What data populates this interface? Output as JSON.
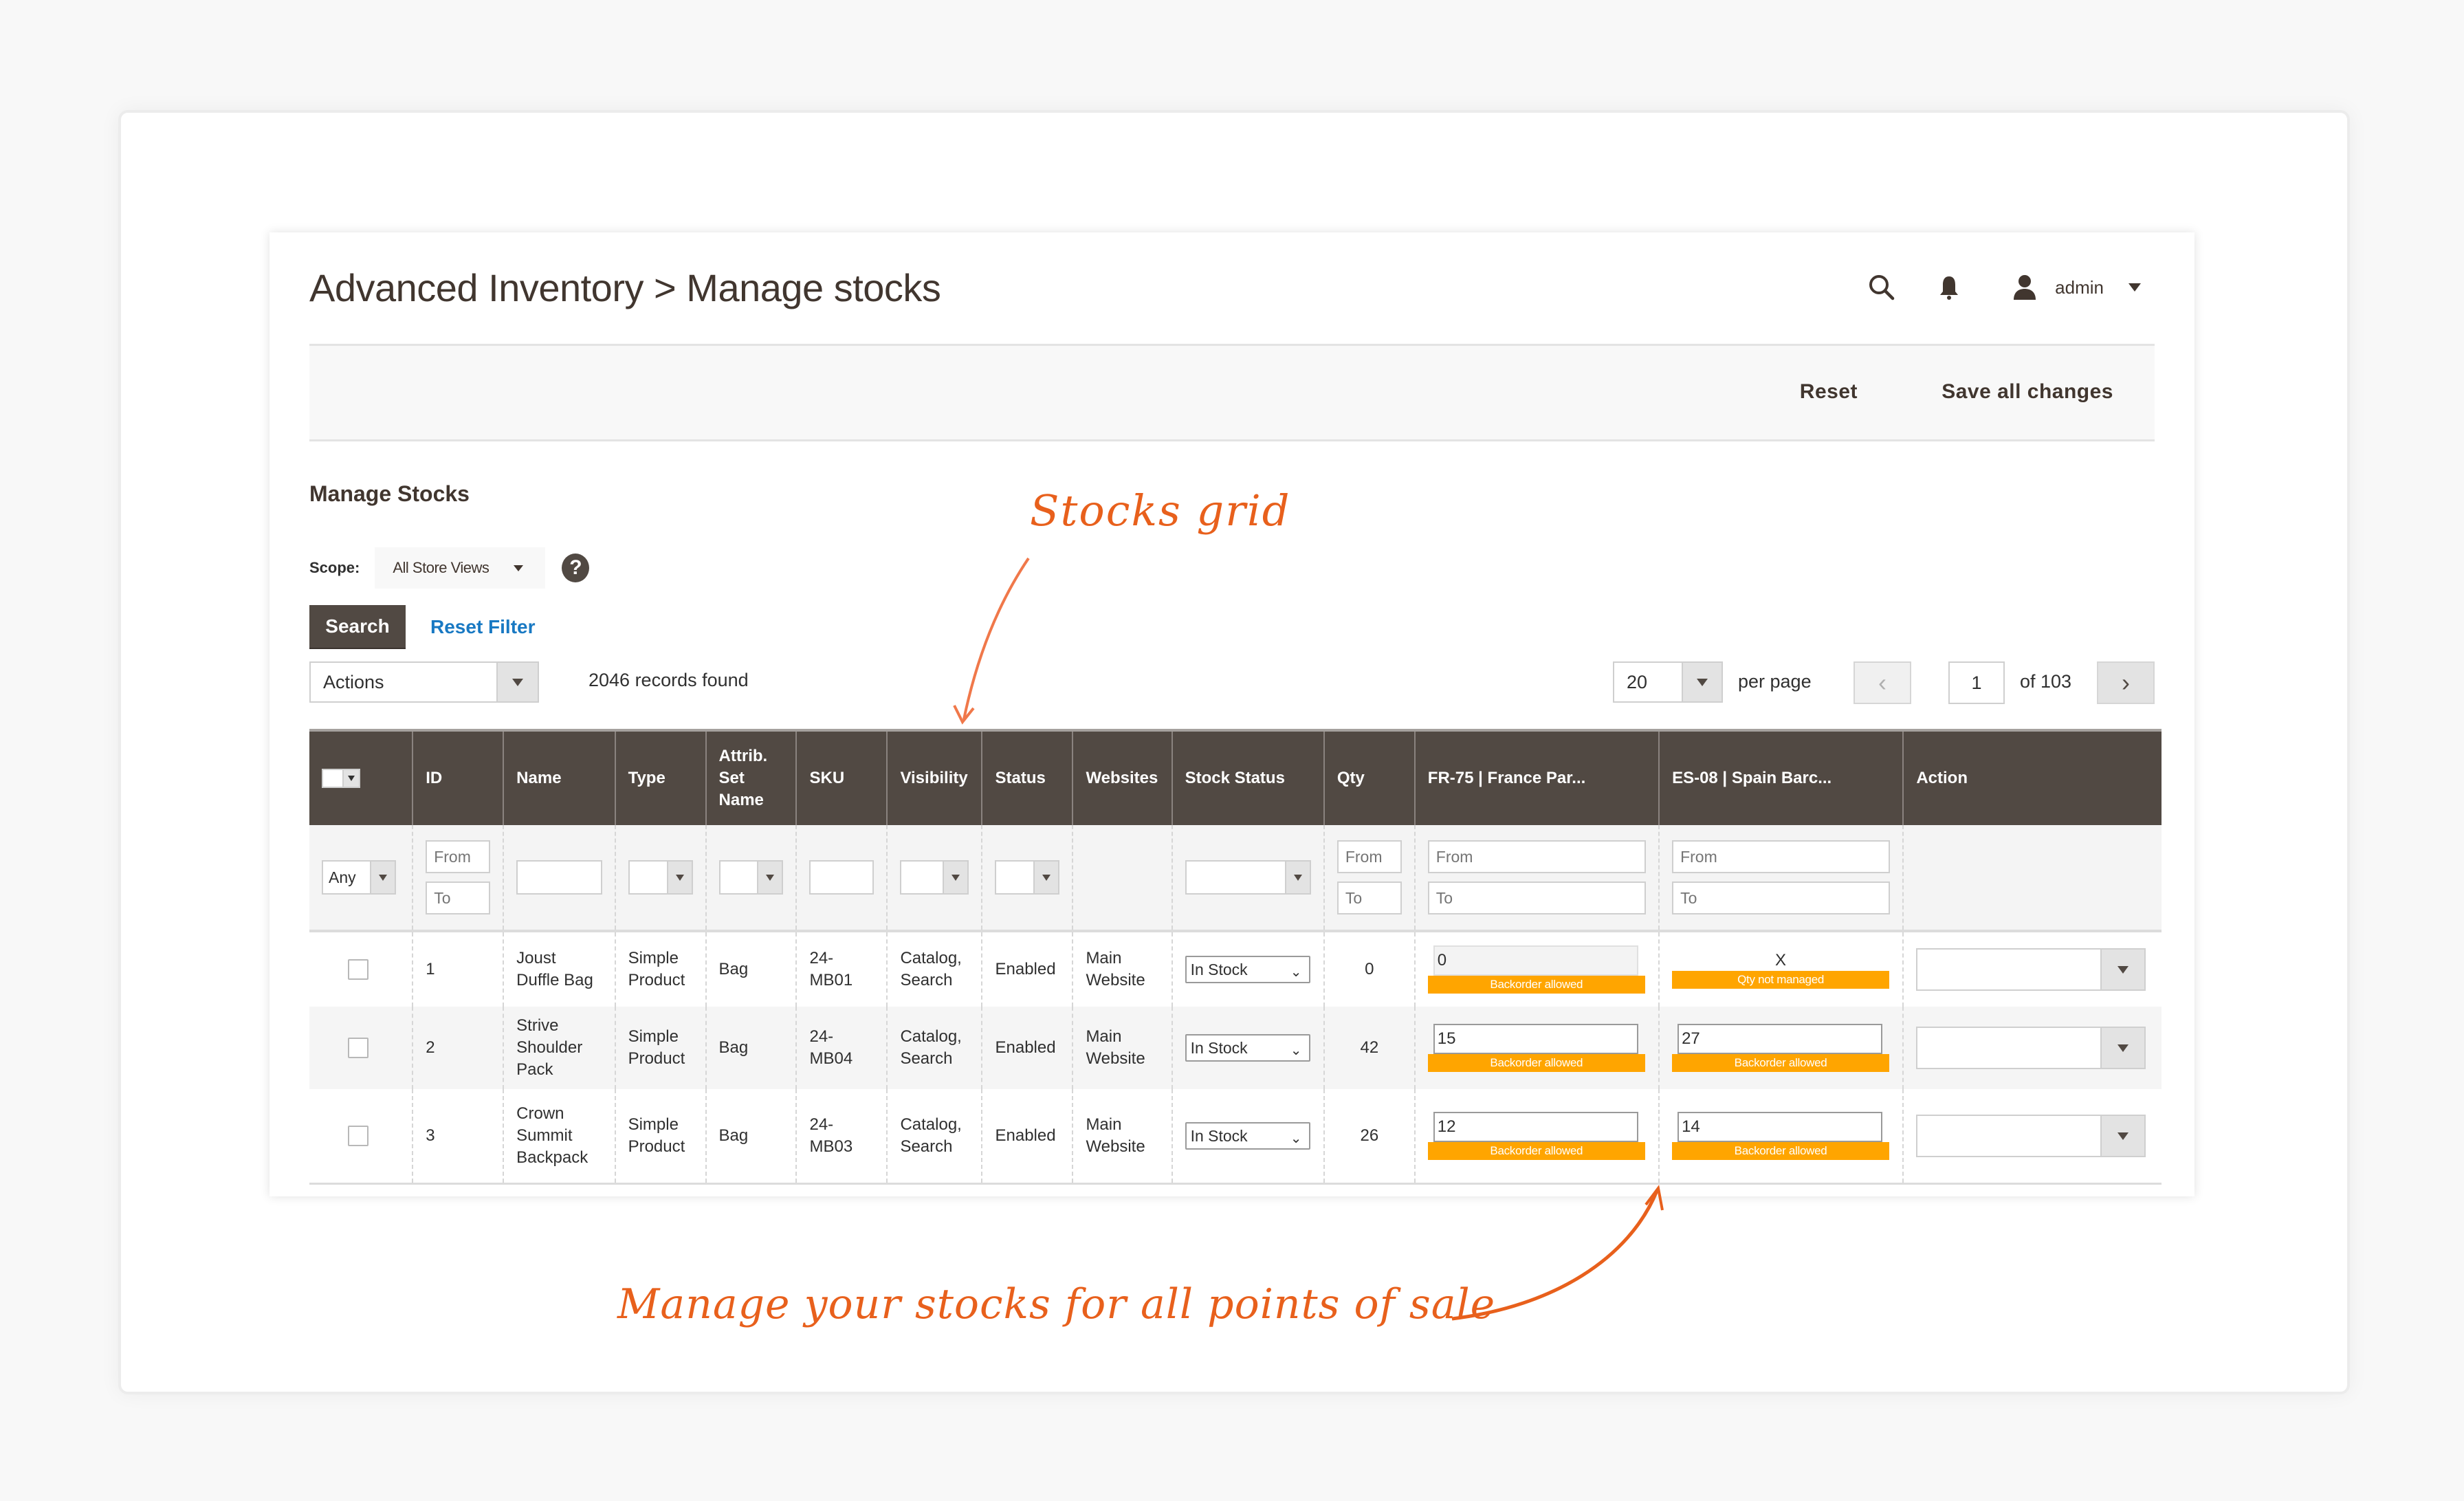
{
  "header": {
    "title": "Advanced Inventory > Manage stocks",
    "user": "admin"
  },
  "action_bar": {
    "reset_label": "Reset",
    "save_label": "Save all changes"
  },
  "section": {
    "title": "Manage Stocks",
    "scope_label": "Scope:",
    "scope_value": "All Store Views",
    "help": "?",
    "search_label": "Search",
    "reset_filter_label": "Reset Filter"
  },
  "toolbar": {
    "actions_value": "Actions",
    "records_found": "2046 records found",
    "per_page_value": "20",
    "per_page_label": "per page",
    "prev": "‹",
    "page": "1",
    "of_pages": "of 103",
    "next": "›"
  },
  "grid": {
    "columns": [
      "",
      "ID",
      "Name",
      "Type",
      "Attrib. Set Name",
      "SKU",
      "Visibility",
      "Status",
      "Websites",
      "Stock Status",
      "Qty",
      "FR-75 | France Par...",
      "ES-08 | Spain Barc...",
      "Action"
    ],
    "filters": {
      "mass_any": "Any",
      "from": "From",
      "to": "To"
    },
    "rows": [
      {
        "id": "1",
        "name": "Joust Duffle Bag",
        "type": "Simple Product",
        "attrib_set": "Bag",
        "sku": "24-MB01",
        "visibility": "Catalog, Search",
        "status": "Enabled",
        "websites": "Main Website",
        "stock_status": "In Stock",
        "qty": "0",
        "pos1": {
          "value": "0",
          "badge": "Backorder allowed",
          "managed": true,
          "disabled": true
        },
        "pos2": {
          "value": "X",
          "badge": "Qty not managed",
          "managed": false
        }
      },
      {
        "id": "2",
        "name": "Strive Shoulder Pack",
        "type": "Simple Product",
        "attrib_set": "Bag",
        "sku": "24-MB04",
        "visibility": "Catalog, Search",
        "status": "Enabled",
        "websites": "Main Website",
        "stock_status": "In Stock",
        "qty": "42",
        "pos1": {
          "value": "15",
          "badge": "Backorder allowed",
          "managed": true
        },
        "pos2": {
          "value": "27",
          "badge": "Backorder allowed",
          "managed": true
        }
      },
      {
        "id": "3",
        "name": "Crown Summit Backpack",
        "type": "Simple Product",
        "attrib_set": "Bag",
        "sku": "24-MB03",
        "visibility": "Catalog, Search",
        "status": "Enabled",
        "websites": "Main Website",
        "stock_status": "In Stock",
        "qty": "26",
        "pos1": {
          "value": "12",
          "badge": "Backorder allowed",
          "managed": true
        },
        "pos2": {
          "value": "14",
          "badge": "Backorder allowed",
          "managed": true
        }
      }
    ]
  },
  "annotations": {
    "grid": "Stocks grid",
    "pos": "Manage your stocks for all points of sale"
  },
  "colors": {
    "header_bg": "#514943",
    "badge": "#ffa500",
    "link": "#1979c3",
    "annotation": "#e8601c"
  }
}
